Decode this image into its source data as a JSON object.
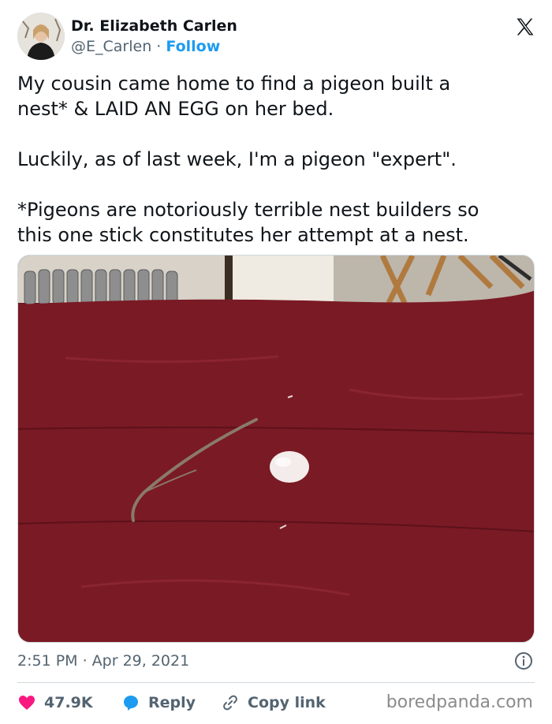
{
  "author": {
    "name": "Dr. Elizabeth Carlen",
    "handle": "@E_Carlen",
    "separator": "·",
    "follow_label": "Follow"
  },
  "tweet": {
    "text": "My cousin came home to find a pigeon built a\nnest* & LAID AN EGG on her bed.\n\nLuckily, as of last week, I'm a pigeon \"expert\".\n\n*Pigeons are notoriously terrible nest builders so\nthis one stick constitutes her attempt at a nest.",
    "timestamp": "2:51 PM · Apr 29, 2021"
  },
  "actions": {
    "likes_count": "47.9K",
    "reply_label": "Reply",
    "copy_link_label": "Copy link"
  },
  "watermark": "boredpanda.com",
  "icons": {
    "logo": "x-logo-icon",
    "info": "info-icon",
    "like": "heart-icon",
    "reply": "reply-bubble-icon",
    "copy": "link-icon"
  },
  "colors": {
    "link": "#1d9bf0",
    "heart": "#f91880",
    "secondary_text": "#536471",
    "bed_cover": "#7a1a24"
  }
}
